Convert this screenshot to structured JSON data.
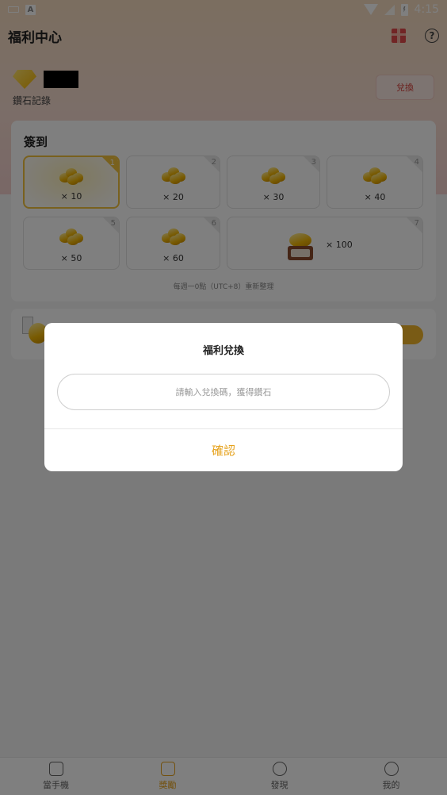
{
  "status_bar": {
    "time": "4:15",
    "a_icon": "A"
  },
  "header": {
    "title": "福利中心",
    "help": "?"
  },
  "diamonds": {
    "record_label": "鑽石記錄",
    "exchange_label": "兌換"
  },
  "checkin": {
    "title": "簽到",
    "days": [
      {
        "day": "1",
        "amount": "× 10"
      },
      {
        "day": "2",
        "amount": "× 20"
      },
      {
        "day": "3",
        "amount": "× 30"
      },
      {
        "day": "4",
        "amount": "× 40"
      },
      {
        "day": "5",
        "amount": "× 50"
      },
      {
        "day": "6",
        "amount": "× 60"
      },
      {
        "day": "7",
        "amount": "× 100"
      }
    ],
    "reset_note": "每週一0點（UTC+8）重新整理"
  },
  "tabs": [
    {
      "label": "當手機",
      "icon": "phone-bag-icon",
      "active": false
    },
    {
      "label": "獎勵",
      "icon": "gift-box-icon",
      "active": true
    },
    {
      "label": "發現",
      "icon": "compass-icon",
      "active": false
    },
    {
      "label": "我的",
      "icon": "profile-icon",
      "active": false
    }
  ],
  "modal": {
    "title": "福利兌換",
    "input_placeholder": "請輸入兌換碼，獲得鑽石",
    "input_value": "",
    "confirm_label": "確認"
  },
  "colors": {
    "accent": "#e6a21c",
    "exchange_text": "#d6403a",
    "gold": "#f3c23c"
  }
}
